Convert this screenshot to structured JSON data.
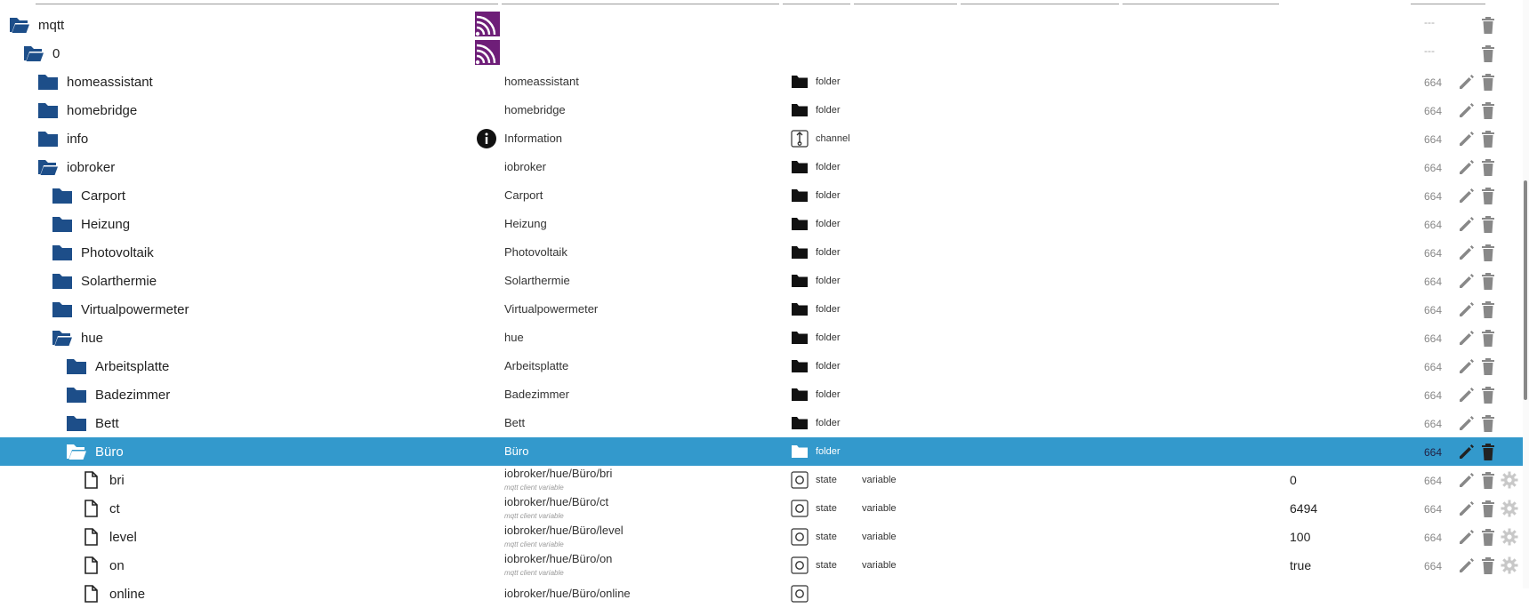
{
  "colors": {
    "selection": "#3399cc",
    "folder": "#1d4e89",
    "adapter_logo": "#6e1e78",
    "icon_gray": "#888888"
  },
  "rows": [
    {
      "name": "mqtt",
      "indent": 0,
      "icon": "folder-open-icon",
      "logo": true,
      "object_name": "",
      "object_subtitle": "",
      "type_icon": "",
      "type": "",
      "role": "",
      "value": "",
      "acl": "---",
      "edit": false,
      "gear": false,
      "selected": false
    },
    {
      "name": "0",
      "indent": 1,
      "icon": "folder-open-icon",
      "logo": true,
      "object_name": "",
      "object_subtitle": "",
      "type_icon": "",
      "type": "",
      "role": "",
      "value": "",
      "acl": "---",
      "edit": false,
      "gear": false,
      "selected": false
    },
    {
      "name": "homeassistant",
      "indent": 2,
      "icon": "folder-icon",
      "logo": false,
      "object_name": "homeassistant",
      "object_subtitle": "",
      "type_icon": "folder-icon",
      "type": "folder",
      "role": "",
      "value": "",
      "acl": "664",
      "edit": true,
      "gear": false,
      "selected": false
    },
    {
      "name": "homebridge",
      "indent": 2,
      "icon": "folder-icon",
      "logo": false,
      "object_name": "homebridge",
      "object_subtitle": "",
      "type_icon": "folder-icon",
      "type": "folder",
      "role": "",
      "value": "",
      "acl": "664",
      "edit": true,
      "gear": false,
      "selected": false
    },
    {
      "name": "info",
      "indent": 2,
      "icon": "folder-icon",
      "logo": false,
      "info_icon": true,
      "object_name": "Information",
      "object_subtitle": "",
      "type_icon": "channel-icon",
      "type": "channel",
      "role": "",
      "value": "",
      "acl": "664",
      "edit": true,
      "gear": false,
      "selected": false
    },
    {
      "name": "iobroker",
      "indent": 2,
      "icon": "folder-open-icon",
      "logo": false,
      "object_name": "iobroker",
      "object_subtitle": "",
      "type_icon": "folder-icon",
      "type": "folder",
      "role": "",
      "value": "",
      "acl": "664",
      "edit": true,
      "gear": false,
      "selected": false
    },
    {
      "name": "Carport",
      "indent": 3,
      "icon": "folder-icon",
      "logo": false,
      "object_name": "Carport",
      "object_subtitle": "",
      "type_icon": "folder-icon",
      "type": "folder",
      "role": "",
      "value": "",
      "acl": "664",
      "edit": true,
      "gear": false,
      "selected": false
    },
    {
      "name": "Heizung",
      "indent": 3,
      "icon": "folder-icon",
      "logo": false,
      "object_name": "Heizung",
      "object_subtitle": "",
      "type_icon": "folder-icon",
      "type": "folder",
      "role": "",
      "value": "",
      "acl": "664",
      "edit": true,
      "gear": false,
      "selected": false
    },
    {
      "name": "Photovoltaik",
      "indent": 3,
      "icon": "folder-icon",
      "logo": false,
      "object_name": "Photovoltaik",
      "object_subtitle": "",
      "type_icon": "folder-icon",
      "type": "folder",
      "role": "",
      "value": "",
      "acl": "664",
      "edit": true,
      "gear": false,
      "selected": false
    },
    {
      "name": "Solarthermie",
      "indent": 3,
      "icon": "folder-icon",
      "logo": false,
      "object_name": "Solarthermie",
      "object_subtitle": "",
      "type_icon": "folder-icon",
      "type": "folder",
      "role": "",
      "value": "",
      "acl": "664",
      "edit": true,
      "gear": false,
      "selected": false
    },
    {
      "name": "Virtualpowermeter",
      "indent": 3,
      "icon": "folder-icon",
      "logo": false,
      "object_name": "Virtualpowermeter",
      "object_subtitle": "",
      "type_icon": "folder-icon",
      "type": "folder",
      "role": "",
      "value": "",
      "acl": "664",
      "edit": true,
      "gear": false,
      "selected": false
    },
    {
      "name": "hue",
      "indent": 3,
      "icon": "folder-open-icon",
      "logo": false,
      "object_name": "hue",
      "object_subtitle": "",
      "type_icon": "folder-icon",
      "type": "folder",
      "role": "",
      "value": "",
      "acl": "664",
      "edit": true,
      "gear": false,
      "selected": false
    },
    {
      "name": "Arbeitsplatte",
      "indent": 4,
      "icon": "folder-icon",
      "logo": false,
      "object_name": "Arbeitsplatte",
      "object_subtitle": "",
      "type_icon": "folder-icon",
      "type": "folder",
      "role": "",
      "value": "",
      "acl": "664",
      "edit": true,
      "gear": false,
      "selected": false
    },
    {
      "name": "Badezimmer",
      "indent": 4,
      "icon": "folder-icon",
      "logo": false,
      "object_name": "Badezimmer",
      "object_subtitle": "",
      "type_icon": "folder-icon",
      "type": "folder",
      "role": "",
      "value": "",
      "acl": "664",
      "edit": true,
      "gear": false,
      "selected": false
    },
    {
      "name": "Bett",
      "indent": 4,
      "icon": "folder-icon",
      "logo": false,
      "object_name": "Bett",
      "object_subtitle": "",
      "type_icon": "folder-icon",
      "type": "folder",
      "role": "",
      "value": "",
      "acl": "664",
      "edit": true,
      "gear": false,
      "selected": false
    },
    {
      "name": "Büro",
      "indent": 4,
      "icon": "folder-open-icon",
      "logo": false,
      "object_name": "Büro",
      "object_subtitle": "",
      "type_icon": "folder-icon",
      "type": "folder",
      "role": "",
      "value": "",
      "acl": "664",
      "edit": true,
      "gear": false,
      "selected": true
    },
    {
      "name": "bri",
      "indent": 5,
      "icon": "file-icon",
      "logo": false,
      "object_name": "iobroker/hue/Büro/bri",
      "object_subtitle": "mqtt client variable",
      "type_icon": "state-icon",
      "type": "state",
      "role": "variable",
      "value": "0",
      "acl": "664",
      "edit": true,
      "gear": true,
      "selected": false
    },
    {
      "name": "ct",
      "indent": 5,
      "icon": "file-icon",
      "logo": false,
      "object_name": "iobroker/hue/Büro/ct",
      "object_subtitle": "mqtt client variable",
      "type_icon": "state-icon",
      "type": "state",
      "role": "variable",
      "value": "6494",
      "acl": "664",
      "edit": true,
      "gear": true,
      "selected": false
    },
    {
      "name": "level",
      "indent": 5,
      "icon": "file-icon",
      "logo": false,
      "object_name": "iobroker/hue/Büro/level",
      "object_subtitle": "mqtt client variable",
      "type_icon": "state-icon",
      "type": "state",
      "role": "variable",
      "value": "100",
      "acl": "664",
      "edit": true,
      "gear": true,
      "selected": false
    },
    {
      "name": "on",
      "indent": 5,
      "icon": "file-icon",
      "logo": false,
      "object_name": "iobroker/hue/Büro/on",
      "object_subtitle": "mqtt client variable",
      "type_icon": "state-icon",
      "type": "state",
      "role": "variable",
      "value": "true",
      "acl": "664",
      "edit": true,
      "gear": true,
      "selected": false
    },
    {
      "name": "online",
      "indent": 5,
      "icon": "file-icon",
      "logo": false,
      "object_name": "iobroker/hue/Büro/online",
      "object_subtitle": "",
      "type_icon": "state-icon",
      "type": "",
      "role": "",
      "value": "",
      "acl": "",
      "edit": false,
      "gear": false,
      "selected": false
    }
  ]
}
